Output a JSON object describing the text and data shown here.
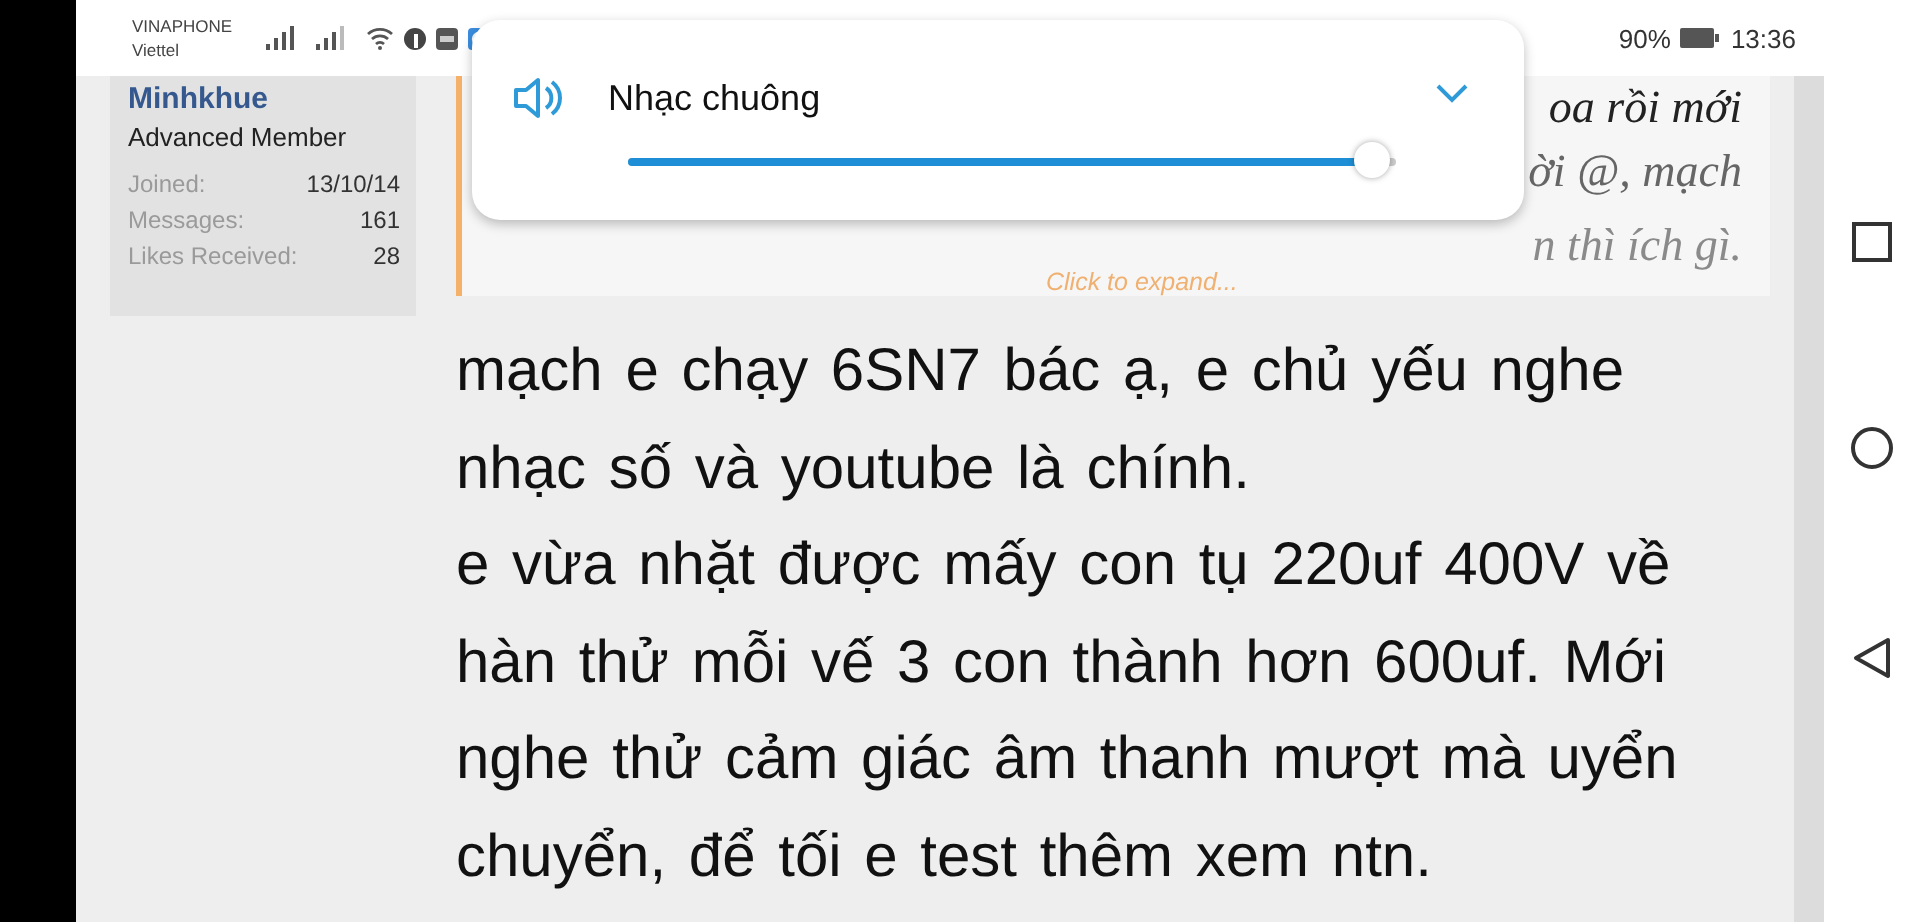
{
  "status_bar": {
    "carriers": [
      "VINAPHONE",
      "Viettel"
    ],
    "battery_text": "90%",
    "time": "13:36"
  },
  "user_card": {
    "name": "Minhkhue",
    "role": "Advanced Member",
    "stats": [
      {
        "label": "Joined:",
        "value": "13/10/14"
      },
      {
        "label": "Messages:",
        "value": "161"
      },
      {
        "label": "Likes Received:",
        "value": "28"
      }
    ]
  },
  "quote": {
    "lines": [
      "oa rồi mới",
      "ời @, mạch",
      "n thì ích gì."
    ],
    "expand_link": "Click to expand..."
  },
  "post": {
    "paragraphs": [
      "mạch e chạy 6SN7 bác ạ, e chủ yếu nghe nhạc số và youtube là chính.",
      "e vừa nhặt được mấy con tụ 220uf 400V về hàn thử mỗi vế 3 con thành hơn 600uf. Mới nghe thử cảm giác âm thanh mượt mà uyển chuyển, để tối e test thêm xem ntn."
    ]
  },
  "volume_popup": {
    "label": "Nhạc chuông",
    "level": 0.97,
    "expanded": false
  }
}
